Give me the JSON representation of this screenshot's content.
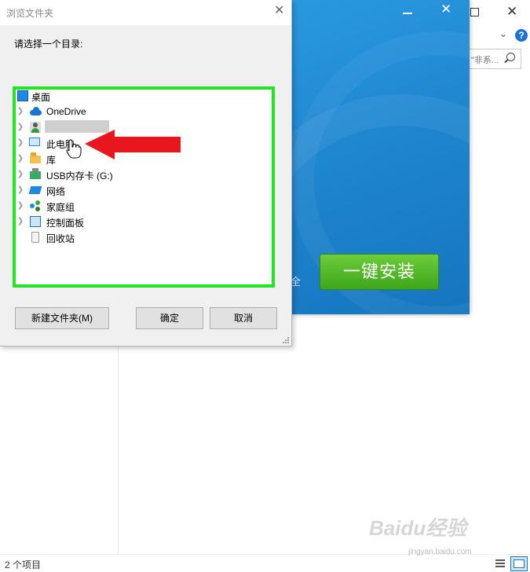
{
  "explorer": {
    "search_placeholder": "\"非系...",
    "status_text": "2 个项目"
  },
  "installer": {
    "install_button": "一键安装",
    "safe_text": "全"
  },
  "dialog": {
    "title": "浏览文件夹",
    "prompt": "请选择一个目录:",
    "tree": [
      {
        "label": "桌面",
        "icon": "desktop-icon",
        "expandable": false
      },
      {
        "label": "OneDrive",
        "icon": "onedrive-cloud-icon",
        "expandable": true
      },
      {
        "label": "",
        "icon": "user-icon",
        "expandable": true
      },
      {
        "label": "此电脑",
        "icon": "computer-icon",
        "expandable": true
      },
      {
        "label": "库",
        "icon": "library-icon",
        "expandable": true
      },
      {
        "label": "USB内存卡 (G:)",
        "icon": "usb-drive-icon",
        "expandable": true
      },
      {
        "label": "网络",
        "icon": "network-icon",
        "expandable": true
      },
      {
        "label": "家庭组",
        "icon": "homegroup-icon",
        "expandable": true
      },
      {
        "label": "控制面板",
        "icon": "control-panel-icon",
        "expandable": true
      },
      {
        "label": "回收站",
        "icon": "recycle-bin-icon",
        "expandable": false
      }
    ],
    "buttons": {
      "new_folder": "新建文件夹(M)",
      "ok": "确定",
      "cancel": "取消"
    }
  },
  "watermark": {
    "brand": "Baidu经验",
    "url": "jingyan.baidu.com"
  },
  "colors": {
    "highlight": "#22e622",
    "arrow": "#e8161d",
    "install_green": "#4cb325",
    "installer_blue": "#1f86d0"
  }
}
